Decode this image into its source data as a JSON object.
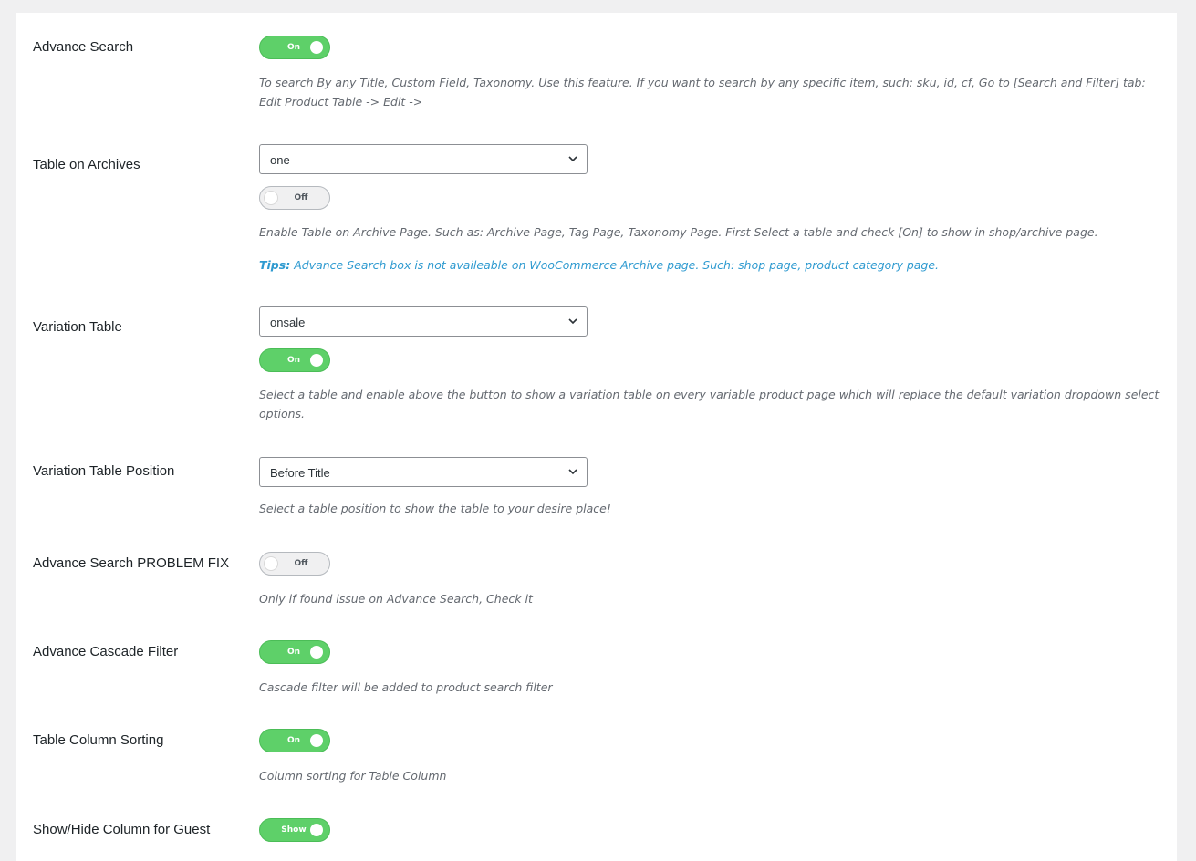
{
  "rows": [
    {
      "label": "Advance Search",
      "toggle": "On",
      "description": "To search By any Title, Custom Field, Taxonomy. Use this feature. If you want to search by any specific item, such: sku, id, cf, Go to [Search and Filter] tab: Edit Product Table -> Edit ->"
    },
    {
      "label": "Table on Archives",
      "select": "one",
      "toggle": "Off",
      "description": "Enable Table on Archive Page. Such as: Archive Page, Tag Page, Taxonomy Page. First Select a table and check [On] to show in shop/archive page.",
      "tips_label": "Tips:",
      "tips_text": "Advance Search box is not availeable on WooCommerce Archive page. Such: shop page, product category page."
    },
    {
      "label": "Variation Table",
      "select": "onsale",
      "toggle": "On",
      "description": "Select a table and enable above the button to show a variation table on every variable product page which will replace the default variation dropdown select options."
    },
    {
      "label": "Variation Table Position",
      "select": "Before Title",
      "description": "Select a table position to show the table to your desire place!"
    },
    {
      "label": "Advance Search PROBLEM FIX",
      "toggle": "Off",
      "description": "Only if found issue on Advance Search, Check it"
    },
    {
      "label": "Advance Cascade Filter",
      "toggle": "On",
      "description": "Cascade filter will be added to product search filter"
    },
    {
      "label": "Table Column Sorting",
      "toggle": "On",
      "description": "Column sorting for Table Column"
    },
    {
      "label": "Show/Hide Column for Guest",
      "toggle": "Show"
    }
  ],
  "colors": {
    "toggle_on": "#5ed069",
    "toggle_off": "#f0f0f1",
    "tips": "#2e9ad0",
    "description": "#646970"
  },
  "icons": {
    "select_arrow": "chevron-down-icon"
  }
}
